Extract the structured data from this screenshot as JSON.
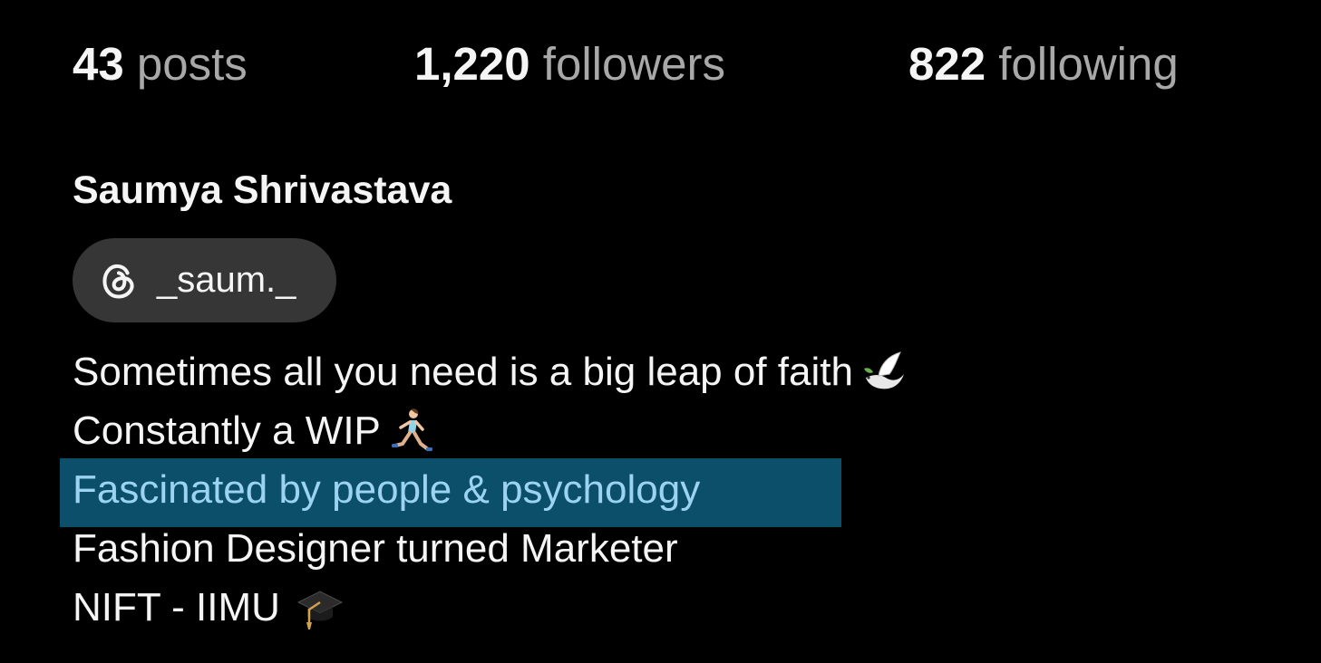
{
  "stats": {
    "posts": {
      "count": "43",
      "label": "posts"
    },
    "followers": {
      "count": "1,220",
      "label": "followers"
    },
    "following": {
      "count": "822",
      "label": "following"
    }
  },
  "profile": {
    "name": "Saumya Shrivastava",
    "threads_handle": "_saum._",
    "threads_icon": "threads-icon"
  },
  "bio": {
    "lines": [
      {
        "text": "Sometimes all you need is a big leap of faith",
        "emoji": "dove-emoji"
      },
      {
        "text": "Constantly a WIP",
        "emoji": "runner-emoji"
      },
      {
        "text": "Fascinated by people & psychology",
        "emoji": null,
        "selected": true
      },
      {
        "text": "Fashion Designer turned Marketer",
        "emoji": null
      },
      {
        "text": "NIFT - IIMU",
        "emoji": "graduation-cap-emoji"
      }
    ]
  },
  "colors": {
    "background": "#000000",
    "text_primary": "#f5f5f5",
    "text_secondary": "#a8a8a8",
    "pill_background": "#363636",
    "selection_background": "#0b4f6b",
    "selection_text": "#9bd3f0"
  }
}
